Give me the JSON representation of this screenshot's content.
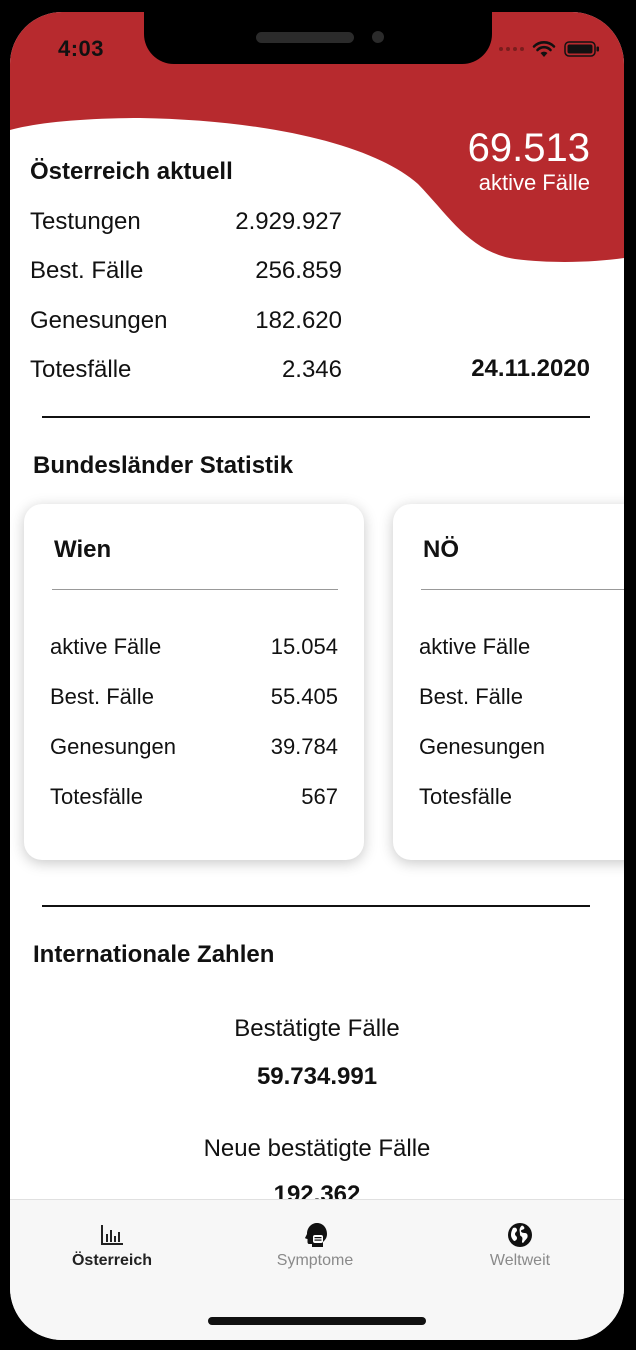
{
  "status_bar": {
    "time": "4:03"
  },
  "header": {
    "active_cases_total": "69.513",
    "active_cases_label": "aktive Fälle"
  },
  "austria": {
    "title": "Österreich aktuell",
    "rows": [
      {
        "label": "Testungen",
        "value": "2.929.927"
      },
      {
        "label": "Best. Fälle",
        "value": "256.859"
      },
      {
        "label": "Genesungen",
        "value": "182.620"
      },
      {
        "label": "Totesfälle",
        "value": "2.346"
      }
    ],
    "date": "24.11.2020"
  },
  "states": {
    "title": "Bundesländer Statistik",
    "cards": [
      {
        "name": "Wien",
        "rows": [
          {
            "label": "aktive Fälle",
            "value": "15.054"
          },
          {
            "label": "Best. Fälle",
            "value": "55.405"
          },
          {
            "label": "Genesungen",
            "value": "39.784"
          },
          {
            "label": "Totesfälle",
            "value": "567"
          }
        ]
      },
      {
        "name": "NÖ",
        "rows": [
          {
            "label": "aktive Fälle",
            "value": ""
          },
          {
            "label": "Best. Fälle",
            "value": ""
          },
          {
            "label": "Genesungen",
            "value": ""
          },
          {
            "label": "Totesfälle",
            "value": ""
          }
        ]
      }
    ]
  },
  "international": {
    "title": "Internationale Zahlen",
    "items": [
      {
        "label": "Bestätigte Fälle",
        "value": "59.734.991"
      },
      {
        "label": "Neue bestätigte Fälle",
        "value": "192.362"
      }
    ]
  },
  "tabs": [
    {
      "label": "Österreich",
      "icon": "bar-chart-icon",
      "active": true
    },
    {
      "label": "Symptome",
      "icon": "head-mask-icon",
      "active": false
    },
    {
      "label": "Weltweit",
      "icon": "globe-icon",
      "active": false
    }
  ],
  "colors": {
    "accent": "#b72a2e",
    "text": "#111111",
    "tab_inactive": "#8a8a8a"
  }
}
